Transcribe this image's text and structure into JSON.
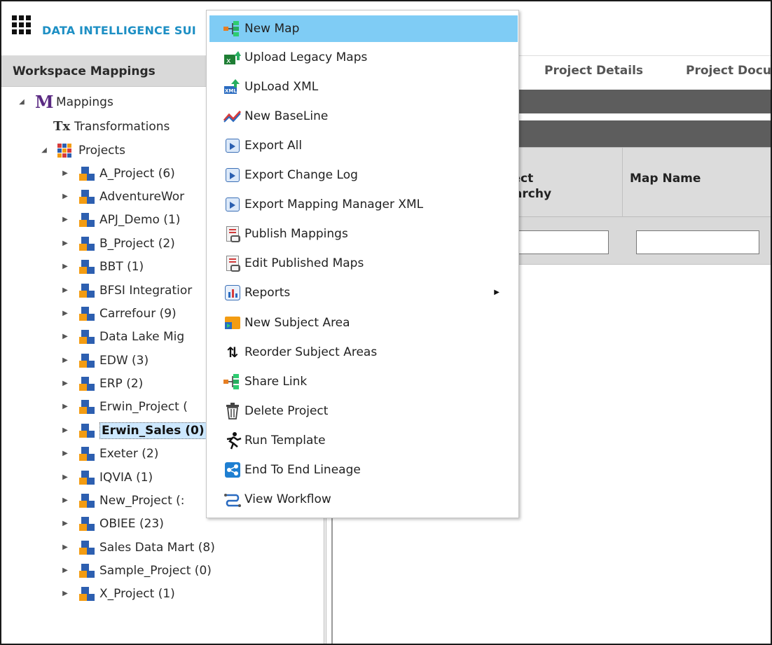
{
  "app": {
    "brand": "DATA INTELLIGENCE SUI"
  },
  "left_panel": {
    "title": "Workspace Mappings"
  },
  "tree": {
    "root": "Mappings",
    "transformations": "Transformations",
    "projects_label": "Projects",
    "projects": [
      "A_Project (6)",
      "AdventureWor",
      "APJ_Demo (1)",
      "B_Project (2)",
      "BBT (1)",
      "BFSI Integratior",
      "Carrefour (9)",
      "Data Lake Mig",
      "EDW (3)",
      "ERP (2)",
      "Erwin_Project (",
      "Erwin_Sales (0)",
      "Exeter (2)",
      "IQVIA (1)",
      "New_Project (:",
      "OBIEE (23)",
      "Sales Data Mart (8)",
      "Sample_Project (0)",
      "X_Project (1)"
    ],
    "selected_project": "Erwin_Sales (0)"
  },
  "tabs": {
    "project_details": "Project Details",
    "project_docs": "Project Docu"
  },
  "table": {
    "headers": [
      {
        "line1": "oject",
        "line2": "erarchy"
      },
      {
        "line1": "Map Name",
        "line2": ""
      }
    ]
  },
  "context_menu": {
    "items": [
      {
        "label": "New Map",
        "icon": "new-map-icon",
        "highlighted": true
      },
      {
        "label": "Upload Legacy Maps",
        "icon": "upload-legacy-maps-icon"
      },
      {
        "label": "UpLoad XML",
        "icon": "upload-xml-icon"
      },
      {
        "label": "New BaseLine",
        "icon": "baseline-icon"
      },
      {
        "label": "Export All",
        "icon": "export-icon"
      },
      {
        "label": "Export Change Log",
        "icon": "export-icon"
      },
      {
        "label": "Export Mapping Manager XML",
        "icon": "export-icon"
      },
      {
        "label": "Publish Mappings",
        "icon": "publish-icon"
      },
      {
        "label": "Edit Published Maps",
        "icon": "publish-icon"
      },
      {
        "label": "Reports",
        "icon": "reports-icon",
        "has_submenu": true
      },
      {
        "label": "New Subject Area",
        "icon": "subject-area-icon"
      },
      {
        "label": "Reorder Subject Areas",
        "icon": "reorder-icon"
      },
      {
        "label": "Share Link",
        "icon": "share-link-icon"
      },
      {
        "label": "Delete Project",
        "icon": "trash-icon"
      },
      {
        "label": "Run Template",
        "icon": "run-icon"
      },
      {
        "label": "End To End Lineage",
        "icon": "lineage-icon"
      },
      {
        "label": "View Workflow",
        "icon": "workflow-icon"
      }
    ]
  },
  "colors": {
    "brand": "#1d8fc4",
    "menu_highlight": "#7fccf5",
    "header_bg": "#d9d9d9",
    "dark_bar": "#5d5d5d",
    "project_blue": "#2d5fb0",
    "project_orange": "#f39c12"
  }
}
